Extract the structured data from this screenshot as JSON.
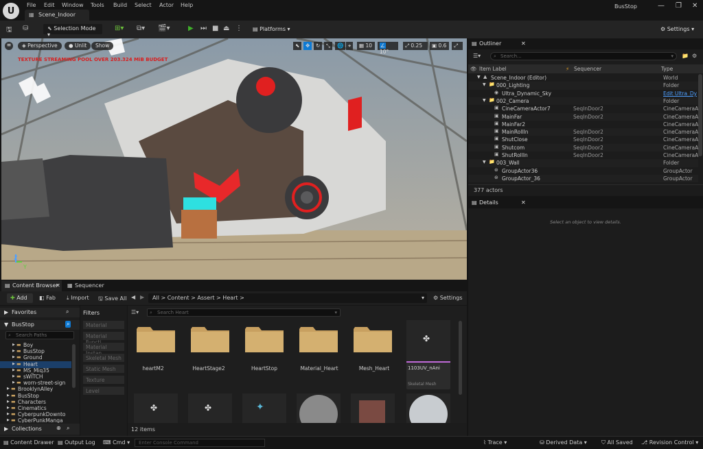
{
  "menu": [
    "File",
    "Edit",
    "Window",
    "Tools",
    "Build",
    "Select",
    "Actor",
    "Help"
  ],
  "level_tab": "Scene_Indoor",
  "app_title": "BusStop",
  "toolbar": {
    "selection_mode": "Selection Mode",
    "platforms": "Platforms",
    "settings": "Settings"
  },
  "viewport": {
    "perspective": "Perspective",
    "unlit": "Unlit",
    "show": "Show",
    "warning": "TEXTURE STREAMING POOL OVER 203.324 MiB BUDGET",
    "grid_snap": "10",
    "rot_snap": "10°",
    "scale_snap": "0.25",
    "cam_speed": "0.6",
    "axis_z": "Z",
    "axis_y": "Y"
  },
  "outliner": {
    "tab": "Outliner",
    "search_placeholder": "Search...",
    "col_label": "Item Label",
    "col_seq": "Sequencer",
    "col_type": "Type",
    "rows": [
      {
        "label": "Scene_Indoor (Editor)",
        "seq": "",
        "type": "World"
      },
      {
        "label": "000_Lighting",
        "seq": "",
        "type": "Folder"
      },
      {
        "label": "Ultra_Dynamic_Sky",
        "seq": "",
        "type": "Edit Ultra_Dy"
      },
      {
        "label": "002_Camera",
        "seq": "",
        "type": "Folder"
      },
      {
        "label": "CineCameraActor7",
        "seq": "SeqInDoor2",
        "type": "CineCameraA"
      },
      {
        "label": "MainFar",
        "seq": "SeqInDoor2",
        "type": "CineCameraA"
      },
      {
        "label": "MainFar2",
        "seq": "",
        "type": "CineCameraA"
      },
      {
        "label": "MainRollIn",
        "seq": "SeqInDoor2",
        "type": "CineCameraA"
      },
      {
        "label": "ShutClose",
        "seq": "SeqInDoor2",
        "type": "CineCameraA"
      },
      {
        "label": "Shutcom",
        "seq": "SeqInDoor2",
        "type": "CineCameraA"
      },
      {
        "label": "ShutRollIn",
        "seq": "SeqInDoor2",
        "type": "CineCameraA"
      },
      {
        "label": "003_Wall",
        "seq": "",
        "type": "Folder"
      },
      {
        "label": "GroupActor36",
        "seq": "",
        "type": "GroupActor"
      },
      {
        "label": "GroupActor_36",
        "seq": "",
        "type": "GroupActor"
      }
    ],
    "count": "377 actors"
  },
  "details": {
    "tab": "Details",
    "empty": "Select an object to view details."
  },
  "content_browser": {
    "tab": "Content Browser",
    "tab2": "Sequencer",
    "add": "Add",
    "fab": "Fab",
    "import": "Import",
    "save_all": "Save All",
    "path": [
      "All",
      "Content",
      "Assert",
      "Heart"
    ],
    "settings": "Settings",
    "favorites": "Favorites",
    "project": "BusStop",
    "search_paths": "Search Paths",
    "tree": [
      "Boy",
      "BusStop",
      "Ground",
      "Heart",
      "MS_Miq35",
      "sWITCH",
      "worn-street-sign",
      "BrooklynAlley",
      "BusStop",
      "Characters",
      "Cinematics",
      "CyberpunkDownto",
      "CyberPunkManga"
    ],
    "collections": "Collections",
    "filters_title": "Filters",
    "filters": [
      "Material",
      "Material Functi",
      "Material Instan",
      "Skeletal Mesh",
      "Static Mesh",
      "Texture",
      "Level"
    ],
    "search_placeholder": "Search Heart",
    "assets": [
      {
        "name": "heartM2"
      },
      {
        "name": "HeartStage2"
      },
      {
        "name": "HeartStop"
      },
      {
        "name": "Material_Heart"
      },
      {
        "name": "Mesh_Heart"
      },
      {
        "name": "1103UV_nAni",
        "subtitle": "Skeletal Mesh"
      }
    ],
    "item_count": "12 items"
  },
  "statusbar": {
    "drawer": "Content Drawer",
    "output": "Output Log",
    "cmd": "Cmd",
    "console_placeholder": "Enter Console Command",
    "trace": "Trace",
    "derived": "Derived Data",
    "saved": "All Saved",
    "revision": "Revision Control"
  },
  "colors": {
    "accent": "#0e7ad4",
    "play": "#3fae2a",
    "warning": "#d81e1e",
    "selected": "#1b3f6a"
  }
}
